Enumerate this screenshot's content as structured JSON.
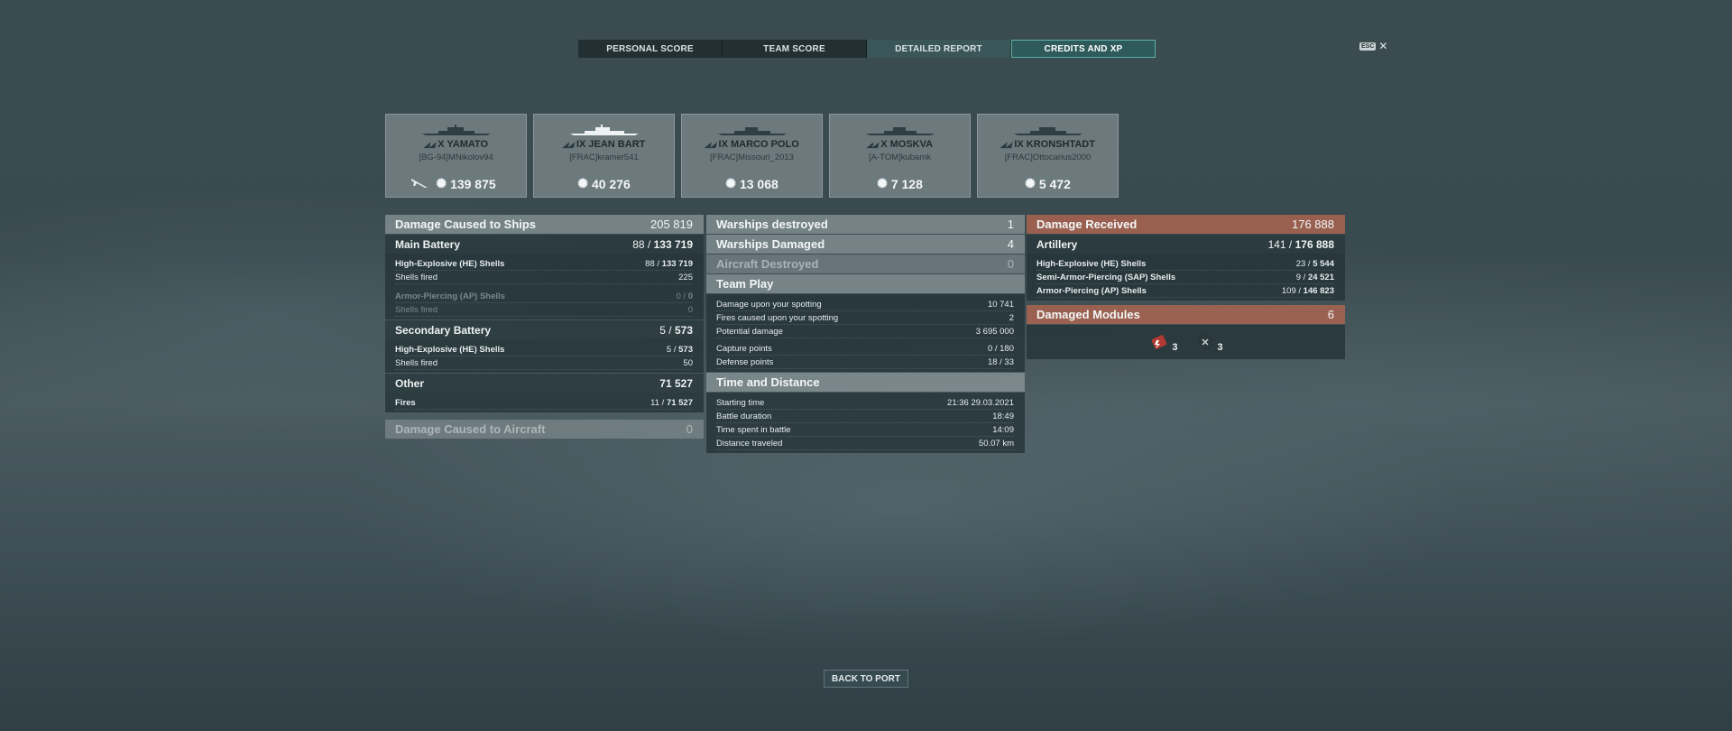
{
  "tabs": [
    {
      "label": "PERSONAL SCORE"
    },
    {
      "label": "TEAM SCORE"
    },
    {
      "label": "DETAILED REPORT"
    },
    {
      "label": "CREDITS AND XP"
    }
  ],
  "esc": {
    "key": "ESC",
    "close": "✕"
  },
  "cards": [
    {
      "ship": "X YAMATO",
      "player": "[BG-94]MNikolov94",
      "score": "139 875"
    },
    {
      "ship": "IX JEAN BART",
      "player": "[FRAC]kramer541",
      "score": "40 276"
    },
    {
      "ship": "IX MARCO POLO",
      "player": "[FRAC]Missouri_2013",
      "score": "13 068"
    },
    {
      "ship": "X MOSKVA",
      "player": "[A-TOM]kubamk",
      "score": "7 128"
    },
    {
      "ship": "IX KRONSHTADT",
      "player": "[FRAC]Ottocarius2000",
      "score": "5 472"
    }
  ],
  "damage": {
    "title": "Damage Caused to Ships",
    "total": "205 819",
    "main_battery": {
      "label": "Main Battery",
      "hits": "88",
      "dmg": "133 719"
    },
    "mb_he": {
      "label": "High-Explosive (HE) Shells",
      "hits": "88",
      "dmg": "133 719"
    },
    "mb_he_fired": {
      "label": "Shells fired",
      "value": "225"
    },
    "mb_ap": {
      "label": "Armor-Piercing (AP) Shells",
      "hits": "0",
      "dmg": "0"
    },
    "mb_ap_fired": {
      "label": "Shells fired",
      "value": "0"
    },
    "secondary": {
      "label": "Secondary Battery",
      "hits": "5",
      "dmg": "573"
    },
    "sec_he": {
      "label": "High-Explosive (HE) Shells",
      "hits": "5",
      "dmg": "573"
    },
    "sec_fired": {
      "label": "Shells fired",
      "value": "50"
    },
    "other": {
      "label": "Other",
      "dmg": "71 527"
    },
    "fires": {
      "label": "Fires",
      "hits": "11",
      "dmg": "71 527"
    },
    "aircraft": {
      "label": "Damage Caused to Aircraft",
      "value": "0"
    }
  },
  "middle": {
    "destroyed": {
      "label": "Warships destroyed",
      "value": "1"
    },
    "damaged": {
      "label": "Warships Damaged",
      "value": "4"
    },
    "aircraft": {
      "label": "Aircraft Destroyed",
      "value": "0"
    },
    "team_play": {
      "title": "Team Play",
      "rows": [
        {
          "label": "Damage upon your spotting",
          "value": "10 741"
        },
        {
          "label": "Fires caused upon your spotting",
          "value": "2"
        },
        {
          "label": "Potential damage",
          "value": "3 695 000"
        },
        {
          "label": "Capture points",
          "value": "0 / 180"
        },
        {
          "label": "Defense points",
          "value": "18 / 33"
        }
      ]
    },
    "time": {
      "title": "Time and Distance",
      "rows": [
        {
          "label": "Starting time",
          "value": "21:36  29.03.2021"
        },
        {
          "label": "Battle duration",
          "value": "18:49"
        },
        {
          "label": "Time spent in battle",
          "value": "14:09"
        },
        {
          "label": "Distance traveled",
          "value": "50.07 km"
        }
      ]
    }
  },
  "received": {
    "title": "Damage Received",
    "total": "176 888",
    "artillery": {
      "label": "Artillery",
      "hits": "141",
      "dmg": "176 888"
    },
    "he": {
      "label": "High-Explosive (HE) Shells",
      "hits": "23",
      "dmg": "5 544"
    },
    "sap": {
      "label": "Semi-Armor-Piercing (SAP) Shells",
      "hits": "9",
      "dmg": "24 521"
    },
    "ap": {
      "label": "Armor-Piercing (AP) Shells",
      "hits": "109",
      "dmg": "146 823"
    },
    "modules": {
      "label": "Damaged Modules",
      "total": "6",
      "engine": "3",
      "steering": "3"
    }
  },
  "back_button": "BACK TO PORT",
  "colors": {
    "orange_header": "#aa6450",
    "tab_selected_border": "#5fb0a8"
  }
}
